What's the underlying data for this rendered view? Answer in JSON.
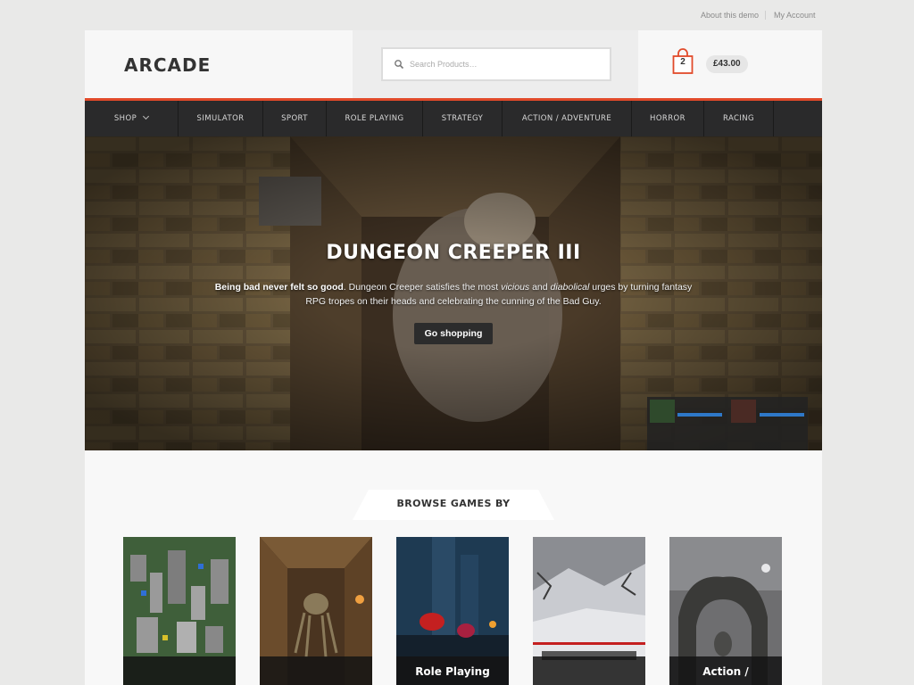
{
  "utility": {
    "about": "About this demo",
    "account": "My Account"
  },
  "header": {
    "logo": "ARCADE",
    "search_placeholder": "Search Products…",
    "cart_count": "2",
    "cart_total": "£43.00"
  },
  "nav": {
    "items": [
      "SHOP",
      "SIMULATOR",
      "SPORT",
      "ROLE PLAYING",
      "STRATEGY",
      "ACTION / ADVENTURE",
      "HORROR",
      "RACING"
    ]
  },
  "hero": {
    "title": "DUNGEON CREEPER III",
    "text_bold": "Being bad never felt so good",
    "text_1": ". Dungeon Creeper satisfies the most ",
    "text_em1": "vicious",
    "text_2": " and ",
    "text_em2": "diabolical",
    "text_3": " urges by turning fantasy RPG tropes on their heads and celebrating the cunning of the Bad Guy.",
    "button": "Go shopping"
  },
  "browse": {
    "title": "BROWSE GAMES BY",
    "categories": [
      {
        "label": ""
      },
      {
        "label": ""
      },
      {
        "label": "Role Playing"
      },
      {
        "label": ""
      },
      {
        "label": "Action /"
      }
    ]
  },
  "colors": {
    "accent": "#e14a2a",
    "nav_bg": "#2a2a2b"
  }
}
